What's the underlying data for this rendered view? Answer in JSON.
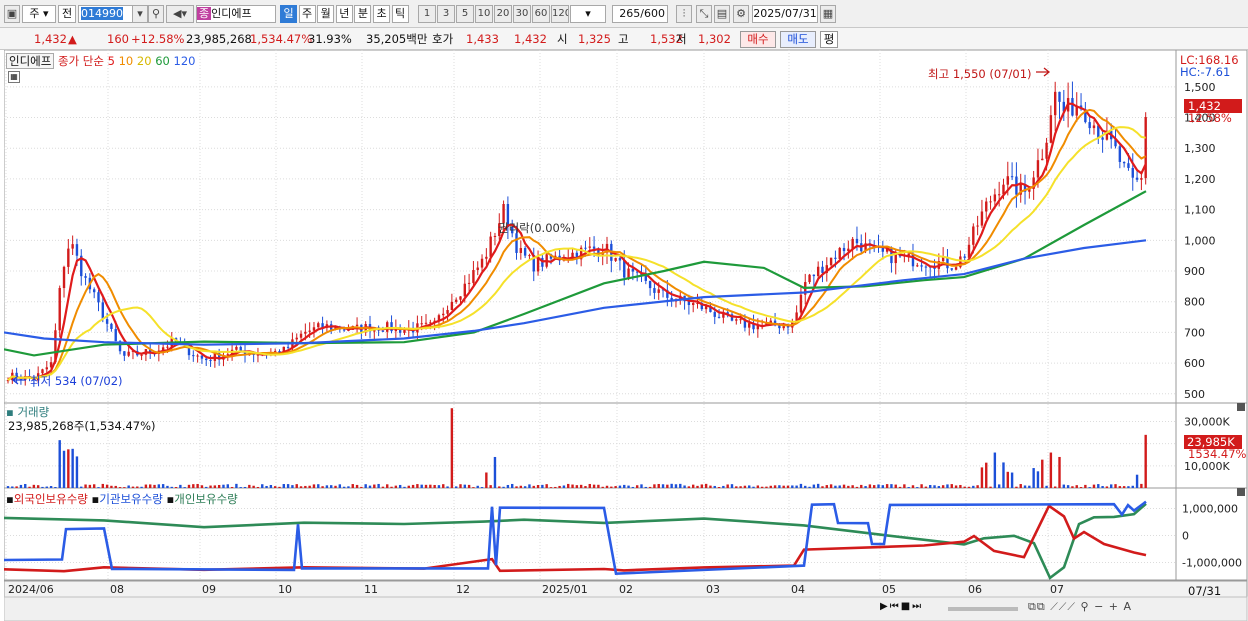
{
  "toolbar": {
    "market": "주",
    "price_mode": "전",
    "code": "014990",
    "name_badge": "종",
    "stock_name": "인디에프",
    "periods": [
      "일",
      "주",
      "월",
      "년",
      "분",
      "초",
      "틱"
    ],
    "active_period": "일",
    "intervals": [
      "1",
      "3",
      "5",
      "10",
      "20",
      "30",
      "60",
      "120"
    ],
    "count": "265",
    "count_max": "/600",
    "date": "2025/07/31"
  },
  "info": {
    "price": "1,432",
    "arrow": "▲",
    "change": "160",
    "change_pct": "+12.58%",
    "volume": "23,985,268",
    "volume_pct": "1,534.47%",
    "turnover": "31.93%",
    "amount": "35,205백만",
    "quote_label": "호가",
    "ask": "1,433",
    "bid": "1,432",
    "open_label": "시",
    "open": "1,325",
    "high_label": "고",
    "high": "1,532",
    "low_label": "저",
    "low": "1,302",
    "buy": "매수",
    "sell": "매도",
    "eval": "평"
  },
  "price_panel": {
    "legend_name": "인디에프",
    "legend_ma_label": "종가 단순",
    "ma_periods": [
      "5",
      "10",
      "20",
      "60",
      "120"
    ],
    "ma_colors": [
      "#e01b1b",
      "#f08c00",
      "#f5e12a",
      "#1e9a3a",
      "#2b5ce6"
    ],
    "lc": "LC:168.16",
    "hc": "HC:-7.61",
    "high_annot": "최고 1,550 (07/01)",
    "low_annot": "최저 534 (07/02)",
    "rights_annot": "권리락(0.00%)",
    "current_price_label": "1,432",
    "current_pct_label": "12.58%",
    "y_ticks": [
      "1,500",
      "1,400",
      "1,300",
      "1,200",
      "1,100",
      "1,000",
      "900",
      "800",
      "700",
      "600",
      "500"
    ]
  },
  "volume_panel": {
    "title": "거래량",
    "value": "23,985,268주(1,534.47%)",
    "y_ticks": [
      "30,000K",
      "20,000K",
      "10,000K"
    ],
    "current_label": "23,985K",
    "current_pct": "1534.47%"
  },
  "holdings_panel": {
    "series_names": [
      "외국인보유수량",
      "기관보유수량",
      "개인보유수량"
    ],
    "series_colors": [
      "#d21b1b",
      "#2b5ce6",
      "#2e8b57"
    ],
    "y_ticks": [
      "1,000,000",
      "0",
      "-1,000,000"
    ]
  },
  "x_axis": {
    "labels": [
      "2024/06",
      "08",
      "09",
      "10",
      "11",
      "12",
      "2025/01",
      "02",
      "03",
      "04",
      "05",
      "06",
      "07"
    ],
    "end_label": "07/31"
  },
  "chart_data": {
    "type": "candlestick",
    "months": [
      "2024/06",
      "08",
      "09",
      "10",
      "11",
      "12",
      "2025/01",
      "02",
      "03",
      "04",
      "05",
      "06",
      "07"
    ],
    "price_ylim": [
      470,
      1620
    ],
    "ma120": [
      [
        0,
        700
      ],
      [
        40,
        680
      ],
      [
        100,
        668
      ],
      [
        200,
        660
      ],
      [
        300,
        665
      ],
      [
        400,
        680
      ],
      [
        470,
        705
      ],
      [
        520,
        730
      ],
      [
        600,
        780
      ],
      [
        700,
        815
      ],
      [
        800,
        830
      ],
      [
        900,
        870
      ],
      [
        960,
        890
      ],
      [
        1020,
        940
      ],
      [
        1080,
        975
      ],
      [
        1142,
        1000
      ]
    ],
    "ma60": [
      [
        0,
        645
      ],
      [
        30,
        625
      ],
      [
        60,
        640
      ],
      [
        100,
        660
      ],
      [
        200,
        670
      ],
      [
        300,
        665
      ],
      [
        400,
        668
      ],
      [
        470,
        700
      ],
      [
        520,
        760
      ],
      [
        600,
        860
      ],
      [
        660,
        900
      ],
      [
        700,
        930
      ],
      [
        760,
        910
      ],
      [
        800,
        845
      ],
      [
        860,
        850
      ],
      [
        920,
        870
      ],
      [
        960,
        880
      ],
      [
        1020,
        940
      ],
      [
        1080,
        1050
      ],
      [
        1142,
        1160
      ]
    ],
    "volume_ylim": [
      0,
      37000000
    ],
    "holdings_ylim": [
      -1650000,
      1650000
    ]
  }
}
